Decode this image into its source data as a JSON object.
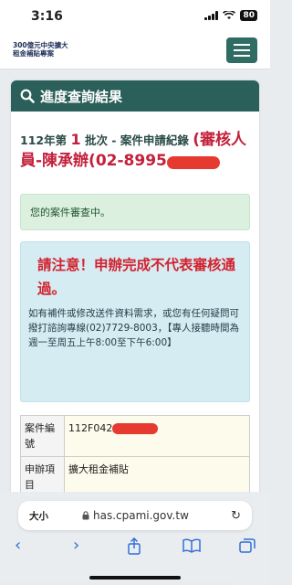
{
  "status": {
    "time": "3:16",
    "battery": "80"
  },
  "nav": {
    "logo_line1": "300億元中央擴大",
    "logo_line2": "租金補貼專案"
  },
  "card": {
    "title": "進度查詢結果",
    "record_prefix": "112年第",
    "batch_no": "1",
    "record_mid": "批次 - 案件申請紀錄",
    "reviewer": "(審核人員-陳承辦(02-8995",
    "status_msg": "您的案件審查中。",
    "notice_title": "請注意！申辦完成不代表審核通過。",
    "notice_body": "如有補件或修改送件資料需求，或您有任何疑問可撥打諮詢專線(02)7729-8003，【專人接聽時間為週一至周五上午8:00至下午6:00】",
    "table": [
      {
        "key": "案件編號",
        "value": "112F042"
      },
      {
        "key": "申辦項目",
        "value": "擴大租金補貼"
      }
    ]
  },
  "browser": {
    "aa": "大小",
    "url": "has.cpami.gov.tw"
  }
}
